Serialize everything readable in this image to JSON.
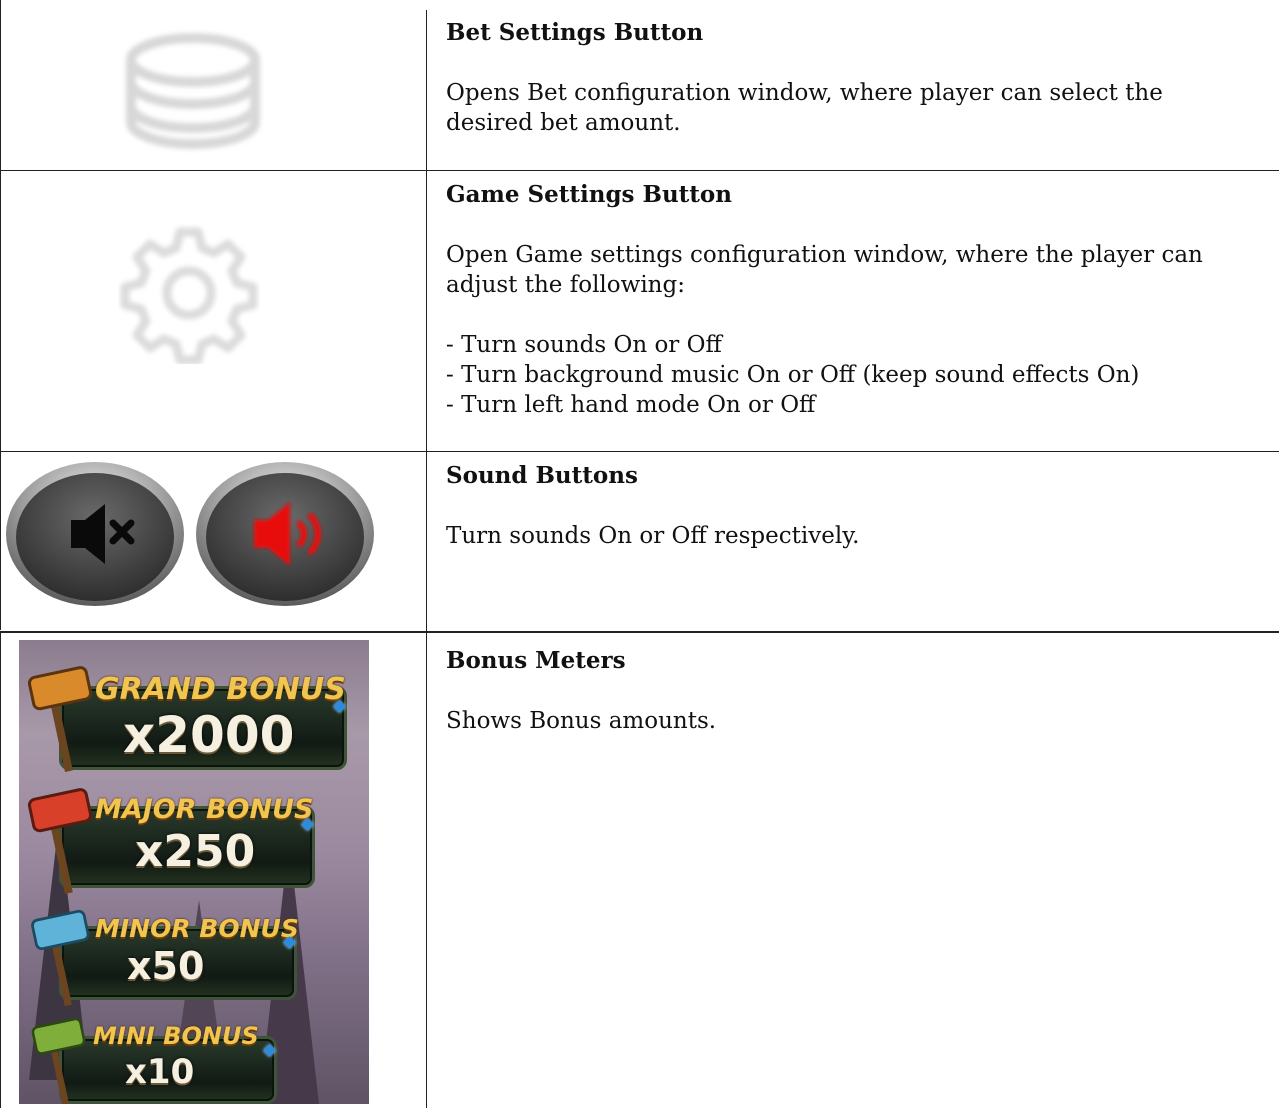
{
  "rows": [
    {
      "heading": "Bet Settings Button",
      "description": "Opens Bet configuration window, where player can select the desired bet amount.",
      "icon": "coin-stack-icon"
    },
    {
      "heading": "Game Settings Button",
      "description": "Open Game settings configuration window, where the player can adjust the following:",
      "options": [
        "- Turn sounds On or Off",
        "- Turn background music On or Off (keep sound effects On)",
        "- Turn left hand mode On or Off"
      ],
      "icon": "gear-icon"
    },
    {
      "heading": "Sound Buttons",
      "description": "Turn sounds On or Off respectively.",
      "icons": [
        "sound-off-icon",
        "sound-on-icon"
      ]
    },
    {
      "heading": "Bonus Meters",
      "description": "Shows Bonus amounts.",
      "meters": [
        {
          "name": "GRAND BONUS",
          "value": "x2000",
          "hammer_color": "#d98a2a"
        },
        {
          "name": "MAJOR BONUS",
          "value": "x250",
          "hammer_color": "#d8402a"
        },
        {
          "name": "MINOR BONUS",
          "value": "x50",
          "hammer_color": "#5fb3d9"
        },
        {
          "name": "MINI BONUS",
          "value": "x10",
          "hammer_color": "#7fae3a"
        }
      ]
    }
  ],
  "colors": {
    "sound_on_accent": "#e81010",
    "meter_text": "#f0c550"
  }
}
